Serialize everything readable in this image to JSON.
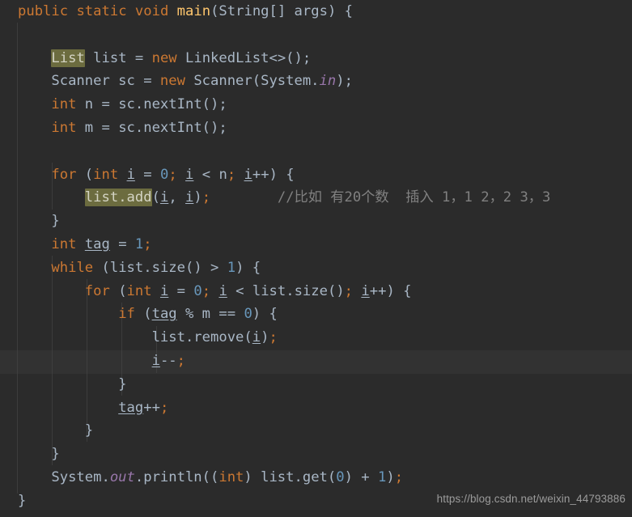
{
  "editor": {
    "language": "Java",
    "theme": "Darcula",
    "colors": {
      "background": "#2B2B2B",
      "foreground": "#A9B7C6",
      "keyword": "#CC7832",
      "number": "#6897BB",
      "comment": "#808080",
      "method_declaration": "#FFC66D",
      "static_field": "#9876AA",
      "search_highlight_bg": "#6C6C3F",
      "caret_line_bg": "#323232",
      "indent_guide": "#4A4A4A"
    },
    "caret_line_number": 16,
    "highlighted_tokens": [
      "List",
      "list.add"
    ]
  },
  "code": {
    "lines": [
      "public static void main(String[] args) {",
      "",
      "    List list = new LinkedList<>();",
      "    Scanner sc = new Scanner(System.in);",
      "    int n = sc.nextInt();",
      "    int m = sc.nextInt();",
      "",
      "    for (int i = 0; i < n; i++) {",
      "        list.add(i, i);        //比如 有20个数  插入 1，1 2，2 3，3",
      "    }",
      "    int tag = 1;",
      "    while (list.size() > 1) {",
      "        for (int i = 0; i < list.size(); i++) {",
      "            if (tag % m == 0) {",
      "                list.remove(i);",
      "                i--;",
      "            }",
      "            tag++;",
      "        }",
      "    }",
      "    System.out.println((int) list.get(0) + 1);",
      "}"
    ],
    "comment_text": "//比如 有20个数  插入 1，1 2，2 3，3"
  },
  "watermark": {
    "url": "https://blog.csdn.net/weixin_44793886"
  }
}
